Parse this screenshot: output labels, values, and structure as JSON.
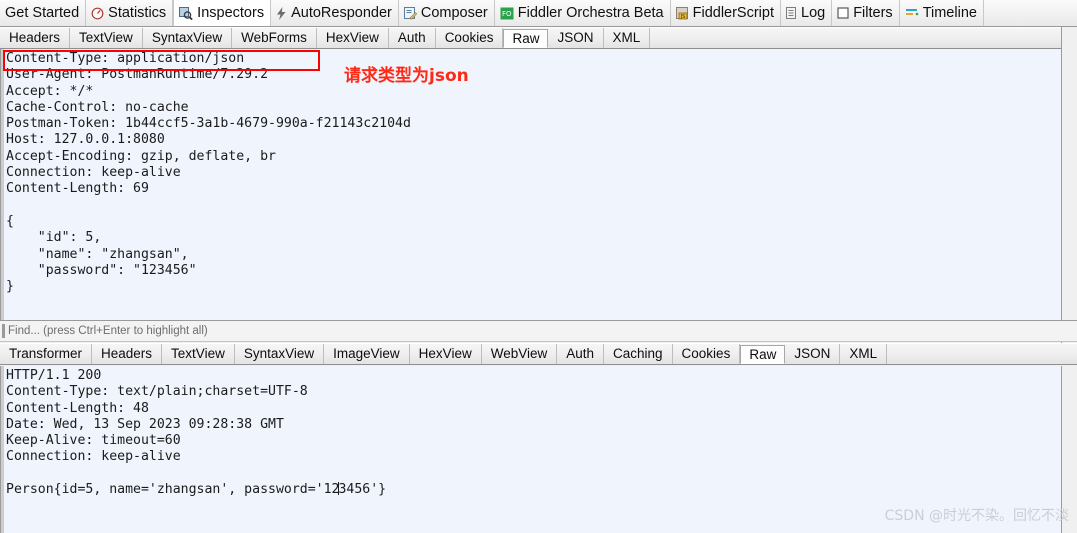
{
  "main_toolbar": {
    "tabs": [
      {
        "label": "Get Started",
        "icon": "none",
        "selected": false
      },
      {
        "label": "Statistics",
        "icon": "statistics-icon",
        "selected": false
      },
      {
        "label": "Inspectors",
        "icon": "inspectors-icon",
        "selected": true
      },
      {
        "label": "AutoResponder",
        "icon": "lightning-icon",
        "selected": false
      },
      {
        "label": "Composer",
        "icon": "compose-icon",
        "selected": false
      },
      {
        "label": "Fiddler Orchestra Beta",
        "icon": "orchestra-icon",
        "selected": false
      },
      {
        "label": "FiddlerScript",
        "icon": "script-icon",
        "selected": false
      },
      {
        "label": "Log",
        "icon": "log-icon",
        "selected": false
      },
      {
        "label": "Filters",
        "icon": "filters-icon",
        "selected": false
      },
      {
        "label": "Timeline",
        "icon": "timeline-icon",
        "selected": false
      }
    ]
  },
  "request": {
    "tabs": [
      {
        "label": "Headers",
        "active": false
      },
      {
        "label": "TextView",
        "active": false
      },
      {
        "label": "SyntaxView",
        "active": false
      },
      {
        "label": "WebForms",
        "active": false
      },
      {
        "label": "HexView",
        "active": false
      },
      {
        "label": "Auth",
        "active": false
      },
      {
        "label": "Cookies",
        "active": false
      },
      {
        "label": "Raw",
        "active": true
      },
      {
        "label": "JSON",
        "active": false
      },
      {
        "label": "XML",
        "active": false
      }
    ],
    "body": "Content-Type: application/json\nUser-Agent: PostmanRuntime/7.29.2\nAccept: */*\nCache-Control: no-cache\nPostman-Token: 1b44ccf5-3a1b-4679-990a-f21143c2104d\nHost: 127.0.0.1:8080\nAccept-Encoding: gzip, deflate, br\nConnection: keep-alive\nContent-Length: 69\n\n{\n    \"id\": 5,\n    \"name\": \"zhangsan\",\n    \"password\": \"123456\"\n}",
    "annotation": {
      "text": "请求类型为json",
      "color": "#ff2a16"
    },
    "highlight_box_color": "#ff0000"
  },
  "find_bar": {
    "placeholder": "Find... (press Ctrl+Enter to highlight all)",
    "value": ""
  },
  "response": {
    "tabs": [
      {
        "label": "Transformer",
        "active": false
      },
      {
        "label": "Headers",
        "active": false
      },
      {
        "label": "TextView",
        "active": false
      },
      {
        "label": "SyntaxView",
        "active": false
      },
      {
        "label": "ImageView",
        "active": false
      },
      {
        "label": "HexView",
        "active": false
      },
      {
        "label": "WebView",
        "active": false
      },
      {
        "label": "Auth",
        "active": false
      },
      {
        "label": "Caching",
        "active": false
      },
      {
        "label": "Cookies",
        "active": false
      },
      {
        "label": "Raw",
        "active": true
      },
      {
        "label": "JSON",
        "active": false
      },
      {
        "label": "XML",
        "active": false
      }
    ],
    "body_before_caret": "HTTP/1.1 200\nContent-Type: text/plain;charset=UTF-8\nContent-Length: 48\nDate: Wed, 13 Sep 2023 09:28:38 GMT\nKeep-Alive: timeout=60\nConnection: keep-alive\n\nPerson{id=5, name='zhangsan', password='12",
    "body_after_caret": "3456'}"
  },
  "watermark": {
    "text": "CSDN @时光不染。回忆不淡"
  }
}
